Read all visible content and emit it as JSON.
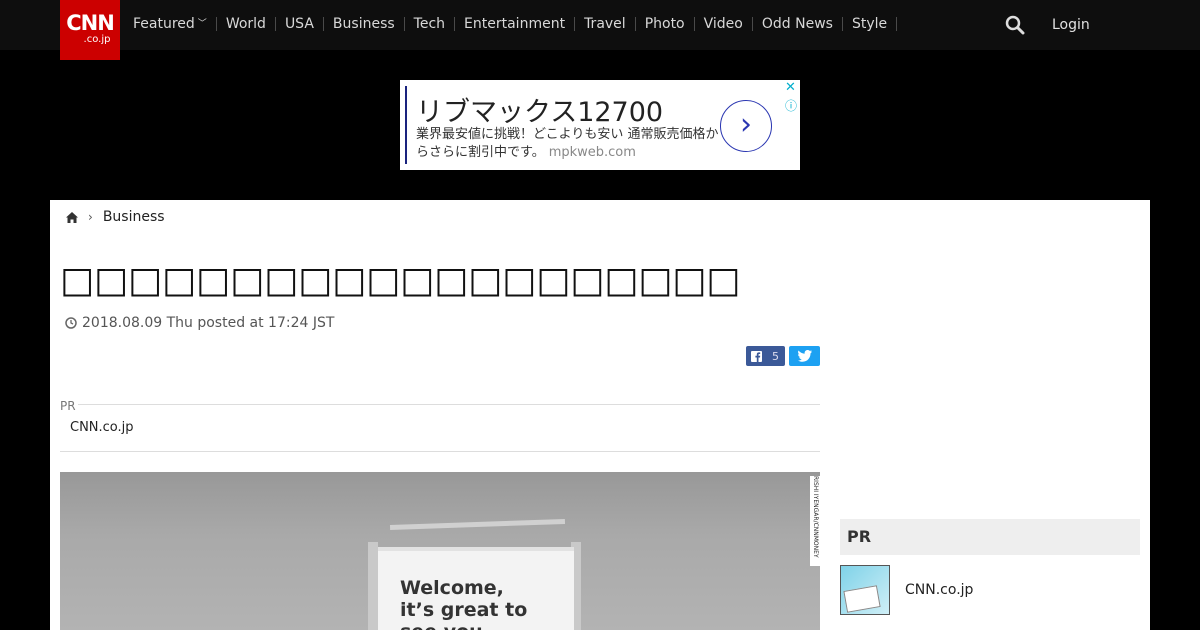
{
  "brand": {
    "logo_main": "CNN",
    "logo_sub": ".co.jp",
    "color": "#cc0000"
  },
  "nav": {
    "items": [
      "Featured",
      "World",
      "USA",
      "Business",
      "Tech",
      "Entertainment",
      "Travel",
      "Photo",
      "Video",
      "Odd News",
      "Style"
    ],
    "login": "Login"
  },
  "ad": {
    "title": "リブマックス12700",
    "description": "業界最安値に挑戦！どこよりも安い 通常販売価格からさらに割引中です。",
    "domain": "mpkweb.com",
    "arrow": "›",
    "close": "✕",
    "info": "ⓘ"
  },
  "breadcrumb": {
    "section": "Business"
  },
  "article": {
    "headline": "□□□□□□□□□□□□□□□□□□□□□□□□□□□□□□□",
    "date": "2018.08.09 Thu posted at 17:24 JST",
    "share_count": "5"
  },
  "pr": {
    "label": "PR",
    "link": "CNN.co.jp"
  },
  "photo": {
    "sign_text": "Welcome,\nit’s great to\nsee you",
    "credit": "RISHI IYENGAR/CNNMONEY"
  },
  "sidebar": {
    "heading": "PR",
    "item_name": "CNN.co.jp"
  },
  "colors": {
    "facebook": "#3b5998",
    "twitter": "#1da1f2",
    "ad_accent": "#2a36b1"
  }
}
